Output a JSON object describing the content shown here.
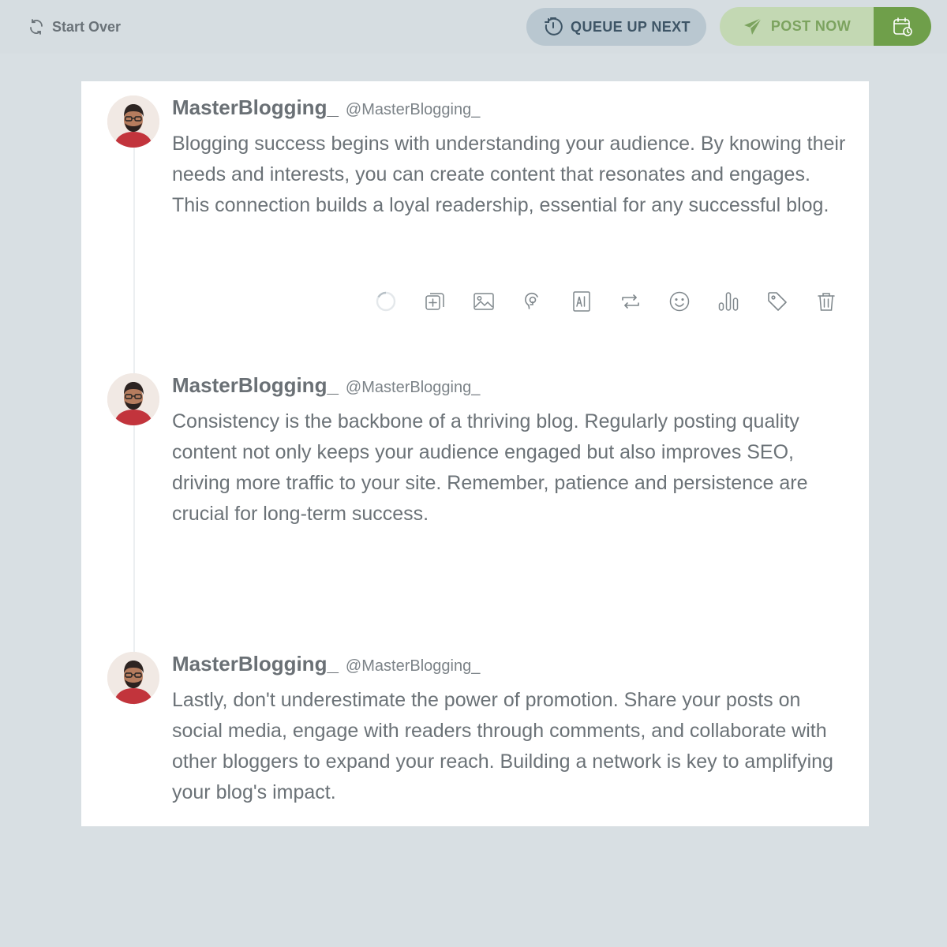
{
  "topbar": {
    "start_over": "Start Over",
    "queue_up_next": "QUEUE UP NEXT",
    "post_now": "POST NOW"
  },
  "colors": {
    "page_bg": "#d8dfe3",
    "queue_bg": "#b9c7d0",
    "post_now_bg": "#c3d8b3",
    "schedule_bg": "#6f9f4a"
  },
  "tweets": [
    {
      "display_name": "MasterBlogging_",
      "handle": "@MasterBlogging_",
      "text": "Blogging success begins with understanding your audience. By knowing their needs and interests, you can create content that resonates and engages. This connection builds a loyal readership, essential for any successful blog."
    },
    {
      "display_name": "MasterBlogging_",
      "handle": "@MasterBlogging_",
      "text": "Consistency is the backbone of a thriving blog. Regularly posting quality content not only keeps your audience engaged but also improves SEO, driving more traffic to your site. Remember, patience and persistence are crucial for long-term success."
    },
    {
      "display_name": "MasterBlogging_",
      "handle": "@MasterBlogging_",
      "text": "Lastly, don't underestimate the power of promotion. Share your posts on social media, engage with readers through comments, and collaborate with other bloggers to expand your reach. Building a network is key to amplifying your blog's impact."
    }
  ],
  "toolbar_icons": [
    "character-count-icon",
    "add-tweet-icon",
    "image-icon",
    "gif-icon",
    "ai-icon",
    "retweet-icon",
    "emoji-icon",
    "poll-icon",
    "tag-icon",
    "trash-icon"
  ]
}
